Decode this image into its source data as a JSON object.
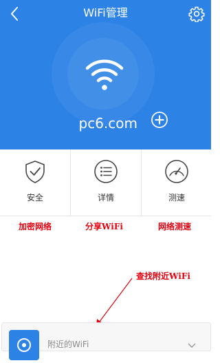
{
  "header": {
    "title": "WiFi管理",
    "back_icon": "chevron-left-icon",
    "settings_icon": "gear-icon",
    "network_name": "pc6.com",
    "add_icon": "plus-circle-icon",
    "wifi_icon": "wifi-icon",
    "background_color": "#2d82e6"
  },
  "actions": [
    {
      "label": "安全",
      "icon": "shield-check-icon"
    },
    {
      "label": "详情",
      "icon": "list-icon"
    },
    {
      "label": "测速",
      "icon": "speedometer-icon"
    }
  ],
  "annotations": {
    "items": [
      "加密网络",
      "分享WiFi",
      "网络测速"
    ],
    "find_nearby": "查找附近WiFi",
    "color": "#e3000f"
  },
  "nearby": {
    "label": "附近的WiFi",
    "icon": "wifi-scan-icon"
  }
}
